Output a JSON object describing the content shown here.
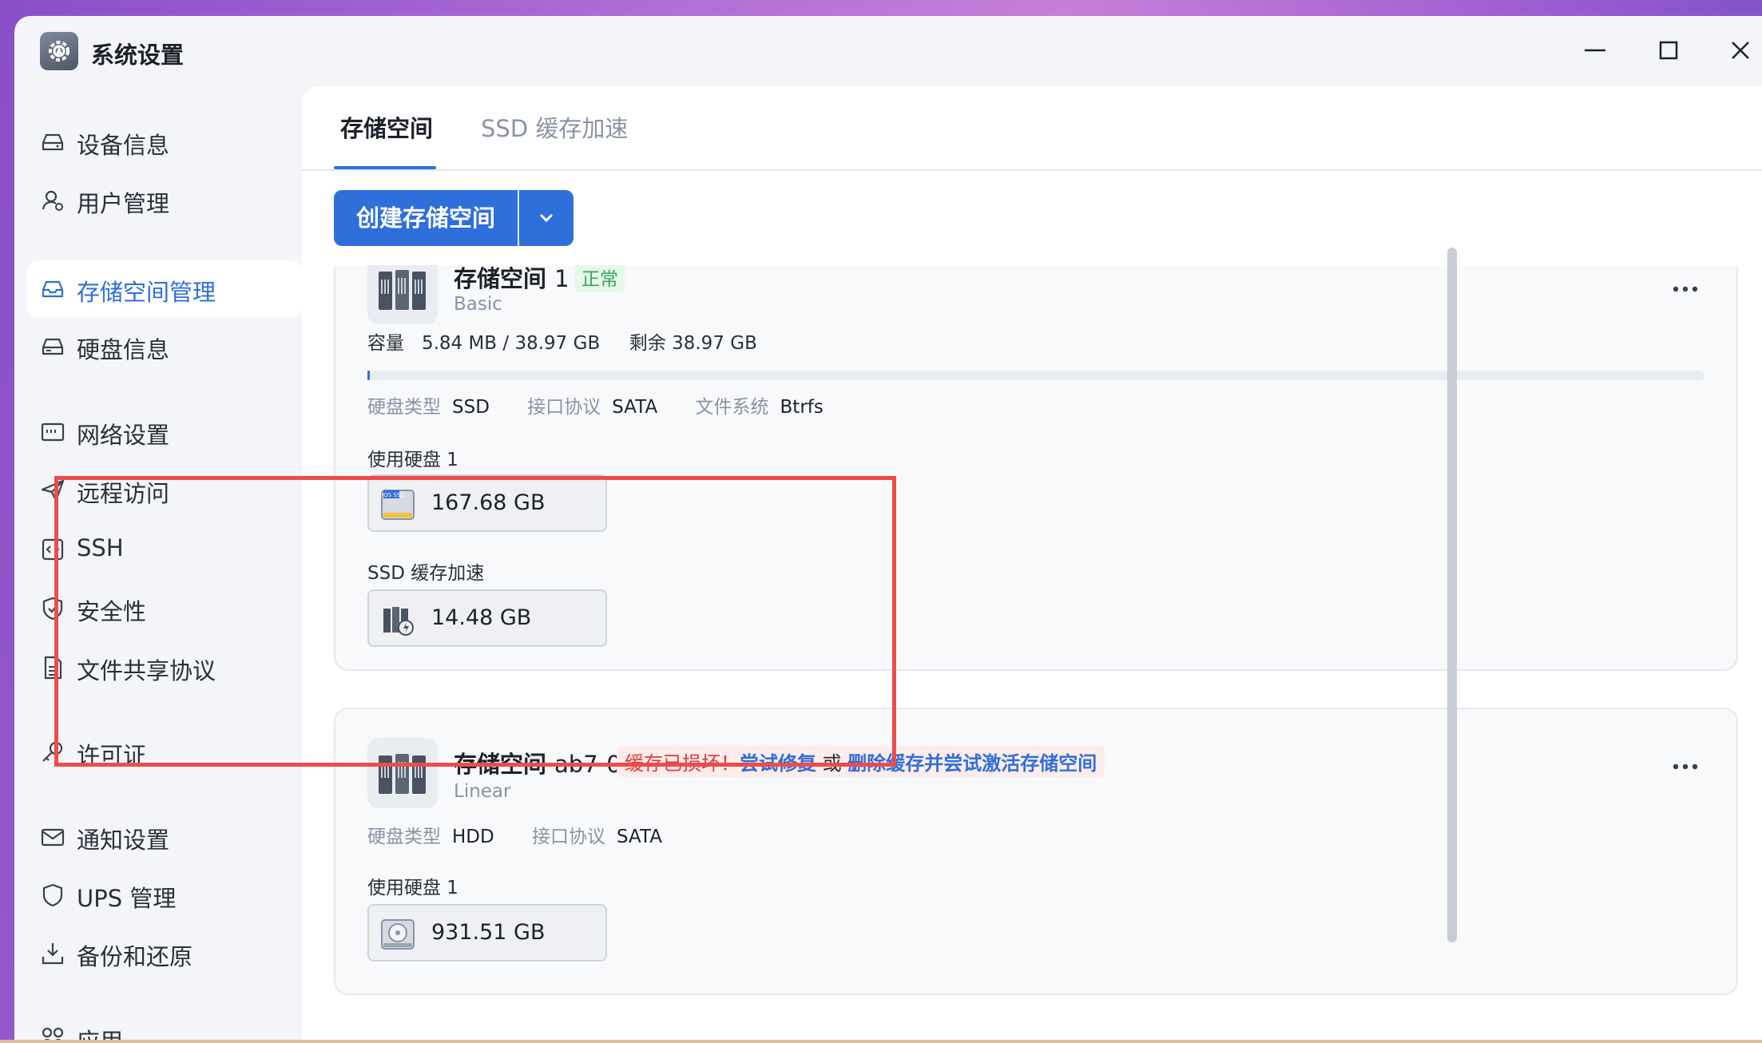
{
  "window": {
    "title": "系统设置"
  },
  "sidebar": {
    "items": [
      {
        "label": "设备信息",
        "icon": "device-icon"
      },
      {
        "label": "用户管理",
        "icon": "user-icon"
      },
      {
        "label": "存储空间管理",
        "icon": "storage-icon",
        "active": true
      },
      {
        "label": "硬盘信息",
        "icon": "disk-icon"
      },
      {
        "label": "网络设置",
        "icon": "network-icon"
      },
      {
        "label": "远程访问",
        "icon": "send-icon"
      },
      {
        "label": "SSH",
        "icon": "code-icon"
      },
      {
        "label": "安全性",
        "icon": "shield-check-icon"
      },
      {
        "label": "文件共享协议",
        "icon": "document-icon"
      },
      {
        "label": "许可证",
        "icon": "key-icon"
      },
      {
        "label": "通知设置",
        "icon": "mail-icon"
      },
      {
        "label": "UPS 管理",
        "icon": "shield-icon"
      },
      {
        "label": "备份和还原",
        "icon": "download-icon"
      },
      {
        "label": "应用",
        "icon": "apps-icon"
      }
    ]
  },
  "tabs": {
    "storage": "存储空间",
    "ssd": "SSD 缓存加速"
  },
  "create_button": {
    "label": "创建存储空间"
  },
  "pool1": {
    "name": "存储空间",
    "number": "1",
    "status": "正常",
    "type": "Basic",
    "capacity_label": "容量",
    "used": "5.84 MB",
    "separator": "/",
    "total": "38.97 GB",
    "remaining_label": "剩余",
    "remaining": "38.97 GB",
    "usage_fraction": 0.0002,
    "disk_type_label": "硬盘类型",
    "disk_type": "SSD",
    "interface_label": "接口协议",
    "interface": "SATA",
    "fs_label": "文件系统",
    "fs": "Btrfs",
    "used_disks_label": "使用硬盘 1",
    "disk_size": "167.68 GB",
    "ssd_cache_label": "SSD 缓存加速",
    "cache_size": "14.48 GB",
    "ssd_badge": "fnOS SSD"
  },
  "pool2": {
    "name": "存储空间",
    "number": "ab7-0",
    "type": "Linear",
    "error_text": "缓存已损坏！",
    "repair_link": "尝试修复",
    "or_text": " 或 ",
    "delete_link": "删除缓存并尝试激活存储空间",
    "disk_type_label": "硬盘类型",
    "disk_type": "HDD",
    "interface_label": "接口协议",
    "interface": "SATA",
    "used_disks_label": "使用硬盘 1",
    "disk_size": "931.51 GB"
  },
  "colors": {
    "accent": "#2f6fdc",
    "error": "#e03a3a",
    "ok": "#3aa55a",
    "highlight": "#ef4b4b"
  }
}
